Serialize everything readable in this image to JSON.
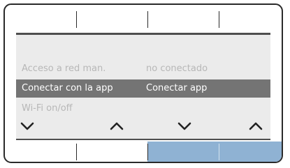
{
  "menu": {
    "rows": [
      {
        "label": "Acceso a red man.",
        "value": "no conectado",
        "state": "dimmed"
      },
      {
        "label": "Conectar con la app",
        "value": "Conectar app",
        "state": "selected"
      },
      {
        "label": "Wi-Fi on/off",
        "value": "",
        "state": "dimmed"
      }
    ]
  },
  "navigation": {
    "arrows": [
      {
        "icon": "chevron-down-icon"
      },
      {
        "icon": "chevron-up-icon"
      },
      {
        "icon": "chevron-down-icon"
      },
      {
        "icon": "chevron-up-icon"
      }
    ]
  },
  "softkeys": {
    "active_indices": [
      2,
      3
    ],
    "active_color": "#8fb2d3"
  },
  "colors": {
    "selection": "#747474",
    "dimmed_text": "#b7b7b7",
    "screen_background": "#ebebeb"
  }
}
